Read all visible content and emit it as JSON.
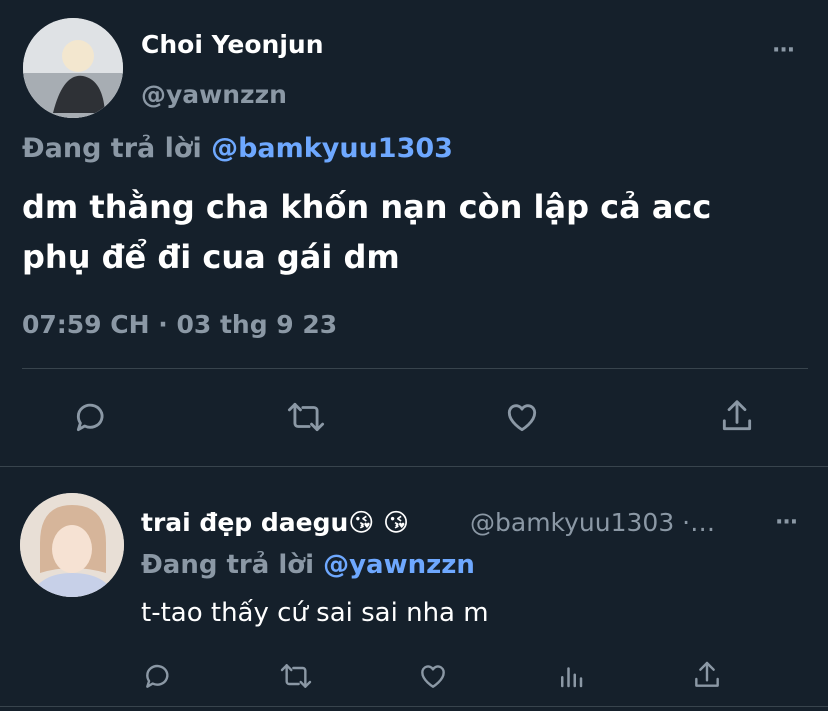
{
  "main_tweet": {
    "display_name": "Choi Yeonjun",
    "handle": "@yawnzzn",
    "reply_prefix": "Đang trả lời",
    "reply_to": "@bamkyuu1303",
    "text_line1": "dm thằng cha khốn nạn còn lập cả acc",
    "text_line2": "phụ để đi cua gái dm",
    "timestamp": "07:59 CH · 03 thg 9 23",
    "more_label": "···"
  },
  "reply_tweet": {
    "display_name": "trai đẹp daegu😘 😘",
    "handle": "@bamkyuu1303 ·…",
    "reply_prefix": "Đang trả lời",
    "reply_to": "@yawnzzn",
    "text": "t-tao thấy cứ sai sai nha m",
    "more_label": "···"
  },
  "colors": {
    "background": "#15202b",
    "text": "#ffffff",
    "muted": "#8b98a5",
    "accent": "#6ea8ff",
    "divider": "#38444d"
  },
  "icons": [
    "reply-icon",
    "retweet-icon",
    "like-icon",
    "share-icon",
    "analytics-icon",
    "more-icon"
  ]
}
